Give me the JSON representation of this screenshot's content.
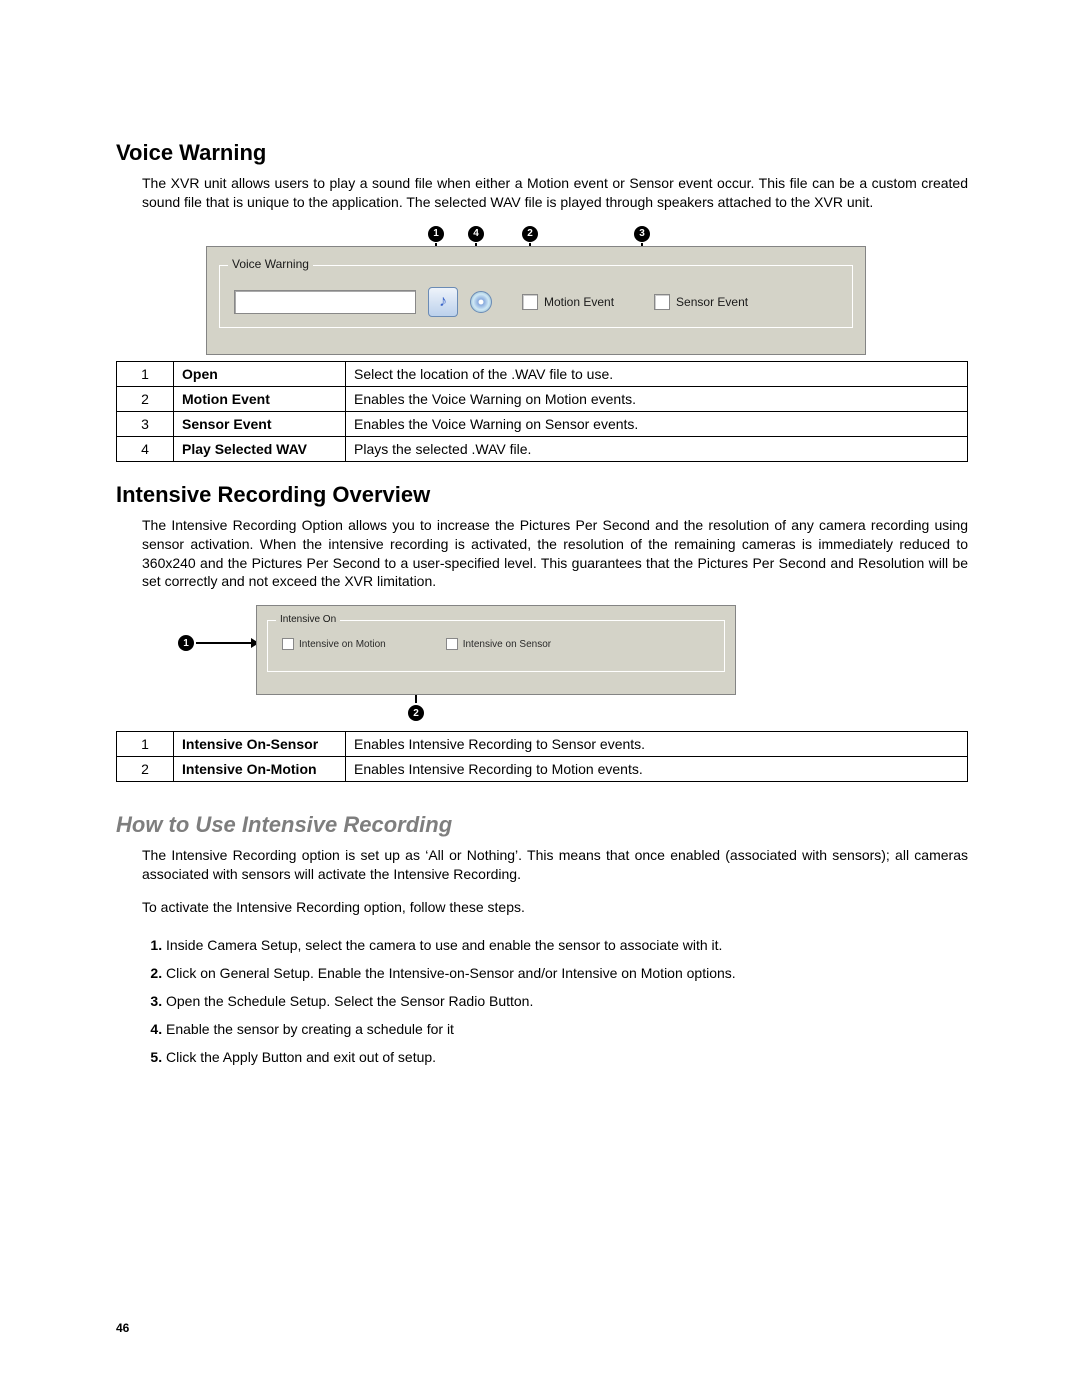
{
  "voice_warning": {
    "heading": "Voice Warning",
    "paragraph": "The XVR unit allows users to play a sound file when either a Motion event or Sensor event occur. This file can be a custom created sound file that is unique to the application. The selected WAV file is played through speakers attached to the XVR unit.",
    "groupbox_title": "Voice Warning",
    "motion_event_label": "Motion Event",
    "sensor_event_label": "Sensor Event",
    "markers": {
      "m1": "1",
      "m4": "4",
      "m2": "2",
      "m3": "3"
    },
    "table": [
      {
        "n": "1",
        "k": "Open",
        "d": "Select the location of the .WAV file to use."
      },
      {
        "n": "2",
        "k": "Motion Event",
        "d": "Enables the Voice Warning on Motion events."
      },
      {
        "n": "3",
        "k": "Sensor Event",
        "d": "Enables the Voice Warning on Sensor events."
      },
      {
        "n": "4",
        "k": "Play Selected WAV",
        "d": "Plays the selected .WAV file."
      }
    ]
  },
  "intensive": {
    "heading": "Intensive Recording Overview",
    "paragraph": "The Intensive Recording Option allows you to increase the Pictures Per Second and the resolution of any camera recording using sensor activation. When the intensive recording is activated, the resolution of the remaining cameras is immediately reduced to 360x240 and the Pictures Per Second to a user-specified level. This guarantees that the Pictures Per Second and Resolution will be set correctly and not exceed the XVR limitation.",
    "groupbox_title": "Intensive On",
    "on_motion_label": "Intensive on Motion",
    "on_sensor_label": "Intensive on Sensor",
    "markers": {
      "m1": "1",
      "m2": "2"
    },
    "table": [
      {
        "n": "1",
        "k": "Intensive On-Sensor",
        "d": "Enables Intensive Recording to Sensor events."
      },
      {
        "n": "2",
        "k": "Intensive On-Motion",
        "d": "Enables Intensive Recording to Motion events."
      }
    ]
  },
  "howto": {
    "heading": "How to Use Intensive Recording",
    "p1": "The Intensive Recording option is set up as ‘All or Nothing’. This means that once enabled (associated with sensors); all cameras associated with sensors will activate the Intensive Recording.",
    "p2": "To activate the Intensive Recording option, follow these steps.",
    "steps": [
      "Inside Camera Setup, select the camera to use and enable the sensor to associate with it.",
      "Click on General Setup. Enable the Intensive-on-Sensor and/or Intensive on Motion options.",
      "Open the Schedule Setup.  Select the Sensor Radio Button.",
      "Enable the sensor by creating a schedule for it",
      "Click the Apply Button and exit out of setup."
    ]
  },
  "page_number": "46"
}
